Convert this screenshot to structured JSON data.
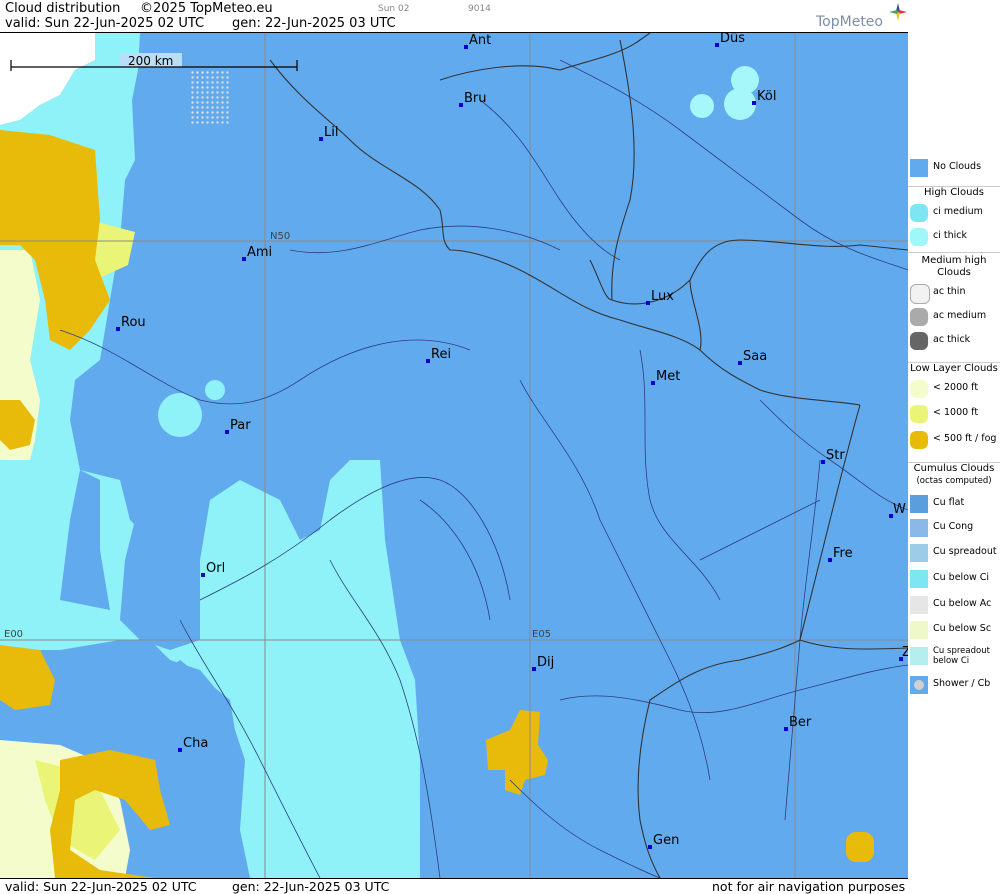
{
  "header": {
    "product": "Cloud distribution",
    "copyright": "©2025 TopMeteo.eu",
    "run": "Sun 02",
    "code": "9014",
    "valid": "valid:  Sun  22-Jun-2025  02 UTC",
    "gen": "gen:  22-Jun-2025 03 UTC",
    "brand": "TopMeteo"
  },
  "footer": {
    "valid": "valid:  Sun  22-Jun-2025  02 UTC",
    "gen": "gen:  22-Jun-2025 03 UTC",
    "disclaimer": "not for air navigation purposes"
  },
  "map": {
    "scale": "200 km",
    "grid_labels": {
      "n50": "N50",
      "e00": "E00",
      "e05": "E05"
    },
    "cities": [
      {
        "name": "Ant"
      },
      {
        "name": "Düs"
      },
      {
        "name": "Köl"
      },
      {
        "name": "Bru"
      },
      {
        "name": "Lil"
      },
      {
        "name": "Ami"
      },
      {
        "name": "Rou"
      },
      {
        "name": "Lux"
      },
      {
        "name": "Rei"
      },
      {
        "name": "Met"
      },
      {
        "name": "Saa"
      },
      {
        "name": "Par"
      },
      {
        "name": "Str"
      },
      {
        "name": "W"
      },
      {
        "name": "Fre"
      },
      {
        "name": "Orl"
      },
      {
        "name": "Dij"
      },
      {
        "name": "Ber"
      },
      {
        "name": "Cha"
      },
      {
        "name": "Gen"
      },
      {
        "name": "Z"
      }
    ],
    "colors": {
      "no_clouds": "#62aaee",
      "ci_medium": "#7ee6f3",
      "ci_thick": "#a0f7fa",
      "low_2000": "#f4fccc",
      "low_1000": "#eaf578",
      "low_500": "#e8bb0a",
      "border": "#333333"
    }
  },
  "legend": {
    "no_clouds": "No Clouds",
    "high_title": "High Clouds",
    "ci_medium": "ci medium",
    "ci_thick": "ci thick",
    "medium_title": "Medium high Clouds",
    "ac_thin": "ac thin",
    "ac_medium": "ac medium",
    "ac_thick": "ac thick",
    "low_title": "Low Layer Clouds",
    "low_2000": "< 2000 ft",
    "low_1000": "< 1000 ft",
    "low_500": "< 500 ft / fog",
    "cu_title": "Cumulus Clouds",
    "cu_sub": "(octas computed)",
    "cu_flat": "Cu flat",
    "cu_cong": "Cu Cong",
    "cu_spread": "Cu spreadout",
    "cu_below_ci": "Cu below Ci",
    "cu_below_ac": "Cu below Ac",
    "cu_below_sc": "Cu below Sc",
    "cu_spread_ci": "Cu spreadout below Ci",
    "shower": "Shower / Cb"
  }
}
